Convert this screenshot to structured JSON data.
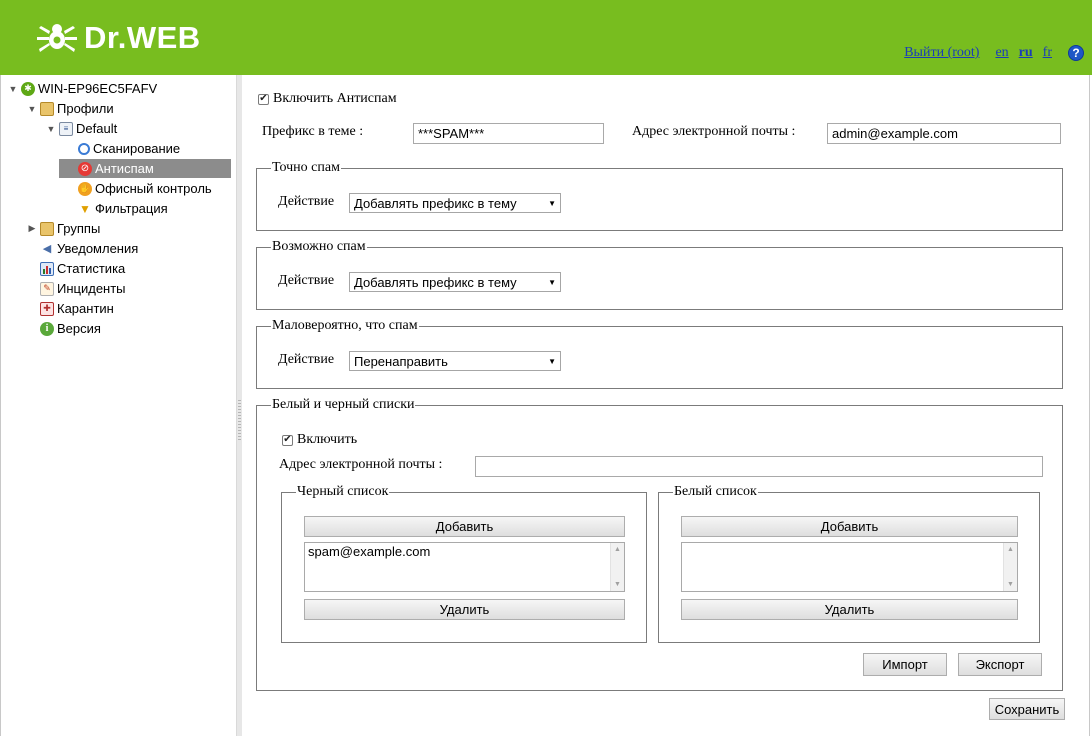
{
  "header": {
    "logo_text": "Dr.WEB",
    "logout_link": "Выйти (root)",
    "languages": [
      "en",
      "ru",
      "fr"
    ],
    "help": "?"
  },
  "sidebar": {
    "items": [
      {
        "label": "WIN-EP96EC5FAFV",
        "icon": "spider-icon"
      },
      {
        "label": "Профили",
        "icon": "folder-icon"
      },
      {
        "label": "Default",
        "icon": "profile-icon"
      },
      {
        "label": "Сканирование",
        "icon": "magnifier-icon"
      },
      {
        "label": "Антиспам",
        "icon": "antispam-icon"
      },
      {
        "label": "Офисный контроль",
        "icon": "hand-icon"
      },
      {
        "label": "Фильтрация",
        "icon": "funnel-icon"
      },
      {
        "label": "Группы",
        "icon": "folder-group-icon"
      },
      {
        "label": "Уведомления",
        "icon": "megaphone-icon"
      },
      {
        "label": "Статистика",
        "icon": "bar-chart-icon"
      },
      {
        "label": "Инциденты",
        "icon": "incident-icon"
      },
      {
        "label": "Карантин",
        "icon": "quarantine-icon"
      },
      {
        "label": "Версия",
        "icon": "info-icon"
      }
    ]
  },
  "main": {
    "enable_antispam": "Включить Антиспам",
    "subject_prefix_label": "Префикс в теме :",
    "subject_prefix_value": "***SPAM***",
    "email_label": "Адрес электронной почты :",
    "email_value": "admin@example.com",
    "sections": {
      "certain_spam": {
        "legend": "Точно спам",
        "action_label": "Действие",
        "action_value": "Добавлять префикс в тему"
      },
      "probable_spam": {
        "legend": "Возможно спам",
        "action_label": "Действие",
        "action_value": "Добавлять префикс в тему"
      },
      "unlikely_spam": {
        "legend": "Маловероятно, что спам",
        "action_label": "Действие",
        "action_value": "Перенаправить"
      }
    },
    "lists": {
      "legend": "Белый и черный списки",
      "enable": "Включить",
      "email_label": "Адрес электронной почты :",
      "email_value": "",
      "black": {
        "legend": "Черный список",
        "add": "Добавить",
        "items": [
          "spam@example.com"
        ],
        "remove": "Удалить"
      },
      "white": {
        "legend": "Белый список",
        "add": "Добавить",
        "items": [],
        "remove": "Удалить"
      },
      "import": "Импорт",
      "export": "Экспорт"
    },
    "save": "Сохранить"
  },
  "colors": {
    "header_green": "#78bd1f",
    "selected_row": "#8c8c8c",
    "link_blue": "#1a3db8"
  }
}
